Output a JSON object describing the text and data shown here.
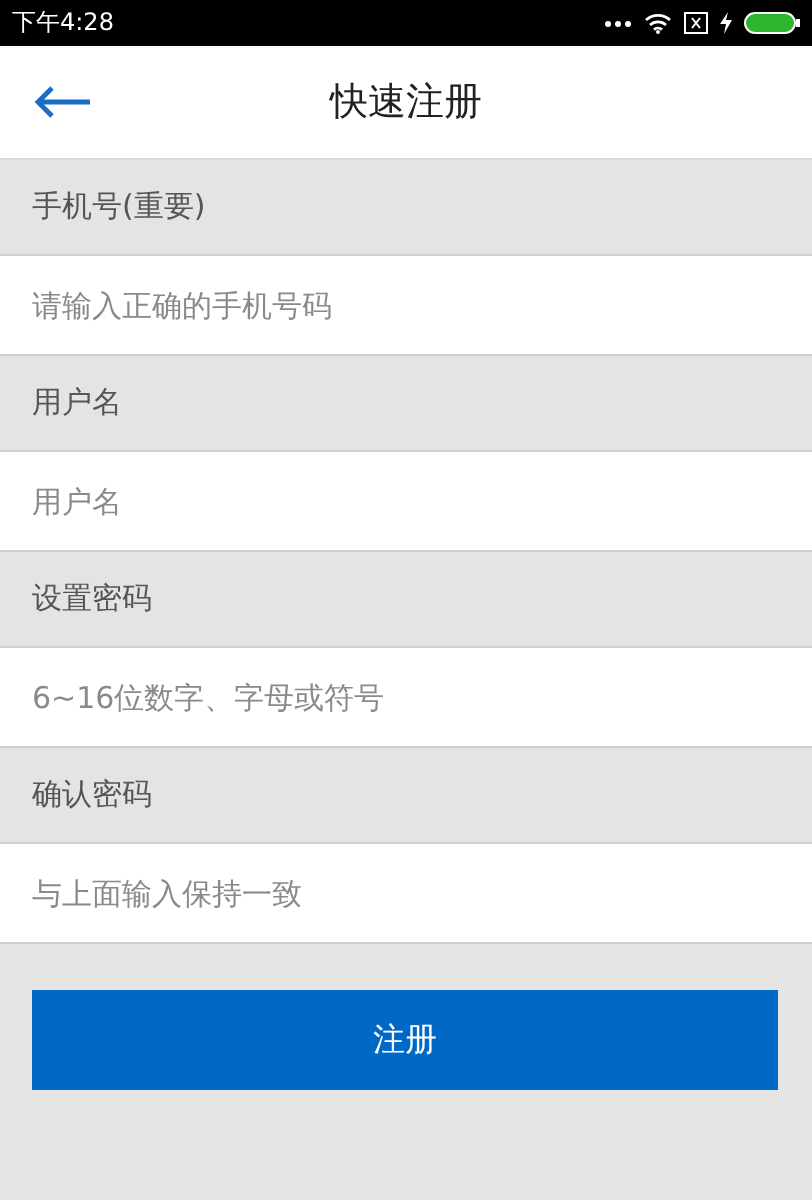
{
  "status_bar": {
    "time": "下午4:28"
  },
  "header": {
    "title": "快速注册"
  },
  "fields": [
    {
      "label": "手机号(重要)",
      "placeholder": "请输入正确的手机号码"
    },
    {
      "label": "用户名",
      "placeholder": "用户名"
    },
    {
      "label": "设置密码",
      "placeholder": "6~16位数字、字母或符号"
    },
    {
      "label": "确认密码",
      "placeholder": "与上面输入保持一致"
    }
  ],
  "submit_button": "注册"
}
